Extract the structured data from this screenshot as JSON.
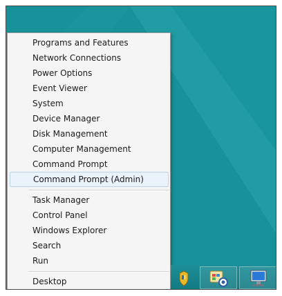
{
  "menu": {
    "items": [
      "Programs and Features",
      "Network Connections",
      "Power Options",
      "Event Viewer",
      "System",
      "Device Manager",
      "Disk Management",
      "Computer Management",
      "Command Prompt",
      "Command Prompt (Admin)",
      "Task Manager",
      "Control Panel",
      "Windows Explorer",
      "Search",
      "Run",
      "Desktop"
    ],
    "highlighted_item": "Command Prompt (Admin)"
  },
  "taskbar": {
    "icons": [
      "shield-icon",
      "control-panel-icon",
      "computer-icon"
    ]
  },
  "colors": {
    "desktop": "#18929b",
    "menu_background": "#f5f5f5",
    "highlight": "#eaf2fb"
  }
}
